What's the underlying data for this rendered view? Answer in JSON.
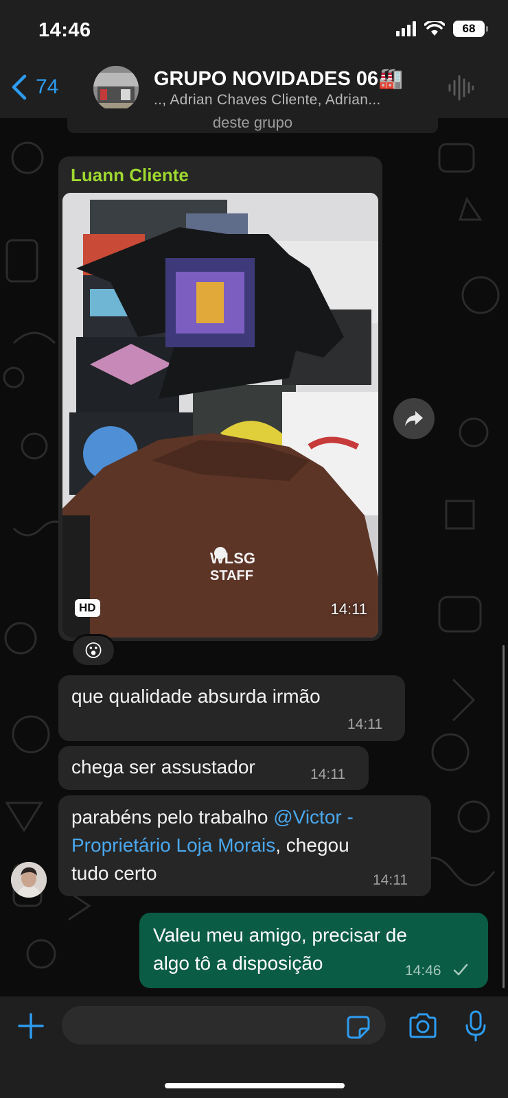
{
  "status": {
    "time": "14:46",
    "battery": "68"
  },
  "header": {
    "back_count": "74",
    "title": "GRUPO NOVIDADES 06",
    "title_emoji": "🏭",
    "subtitle": ".., Adrian Chaves Cliente, Adrian..."
  },
  "system_notice": "deste grupo",
  "messages": [
    {
      "sender": "Luann Cliente",
      "type": "image",
      "badge": "HD",
      "time": "14:11",
      "reaction": "😮"
    },
    {
      "text": "que qualidade absurda irmão",
      "time": "14:11"
    },
    {
      "text": "chega ser assustador",
      "time": "14:11"
    },
    {
      "text_before": "parabéns pelo trabalho ",
      "mention_line1": "@Victor -",
      "mention_line2": "Proprietário Loja Morais",
      "text_after": ", chegou",
      "text_line3": "tudo certo",
      "time": "14:11"
    },
    {
      "outgoing": true,
      "line1": "Valeu meu amigo, precisar de",
      "line2": "algo tô a disposição",
      "time": "14:46"
    }
  ],
  "icons": {
    "back": "chevron-left-icon",
    "waveform": "voice-chat-icon",
    "forward": "forward-icon",
    "plus": "plus-icon",
    "sticker": "sticker-icon",
    "camera": "camera-icon",
    "mic": "microphone-icon"
  },
  "colors": {
    "accent": "#2d9cf0",
    "sender_name": "#9fd930",
    "incoming_bubble": "#262626",
    "outgoing_bubble": "#0b5c45",
    "mention": "#4aa8ee"
  }
}
